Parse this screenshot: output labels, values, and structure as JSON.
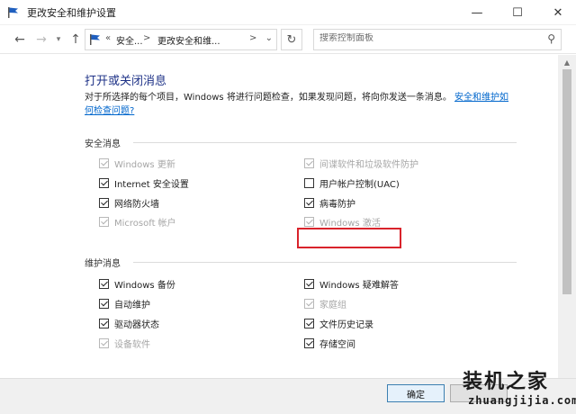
{
  "window": {
    "title": "更改安全和维护设置"
  },
  "nav": {
    "crumb_prefix": "«",
    "crumbs": [
      "安全...",
      "更改安全和维..."
    ],
    "separator": ">",
    "search_placeholder": "搜索控制面板"
  },
  "content": {
    "heading": "打开或关闭消息",
    "description": "对于所选择的每个项目，Windows 将进行问题检查，如果发现问题，将向你发送一条消息。",
    "help_link": "安全和维护如何检查问题?",
    "security_group": {
      "title": "安全消息",
      "items": [
        {
          "label": "Windows 更新",
          "checked": true,
          "enabled": false
        },
        {
          "label": "间谍软件和垃圾软件防护",
          "checked": true,
          "enabled": false
        },
        {
          "label": "Internet 安全设置",
          "checked": true,
          "enabled": true
        },
        {
          "label": "用户帐户控制(UAC)",
          "checked": false,
          "enabled": true
        },
        {
          "label": "网络防火墙",
          "checked": true,
          "enabled": true
        },
        {
          "label": "病毒防护",
          "checked": true,
          "enabled": true
        },
        {
          "label": "Microsoft 帐户",
          "checked": true,
          "enabled": false
        },
        {
          "label": "Windows 激活",
          "checked": true,
          "enabled": false
        }
      ]
    },
    "maintenance_group": {
      "title": "维护消息",
      "items": [
        {
          "label": "Windows 备份",
          "checked": true,
          "enabled": true
        },
        {
          "label": "Windows 疑难解答",
          "checked": true,
          "enabled": true
        },
        {
          "label": "自动维护",
          "checked": true,
          "enabled": true
        },
        {
          "label": "家庭组",
          "checked": true,
          "enabled": false
        },
        {
          "label": "驱动器状态",
          "checked": true,
          "enabled": true
        },
        {
          "label": "文件历史记录",
          "checked": true,
          "enabled": true
        },
        {
          "label": "设备软件",
          "checked": true,
          "enabled": false
        },
        {
          "label": "存储空间",
          "checked": true,
          "enabled": true
        }
      ]
    }
  },
  "footer": {
    "ok_label": "确定"
  },
  "watermark": {
    "text": "装机之家",
    "url": "zhuangjijia.com"
  }
}
